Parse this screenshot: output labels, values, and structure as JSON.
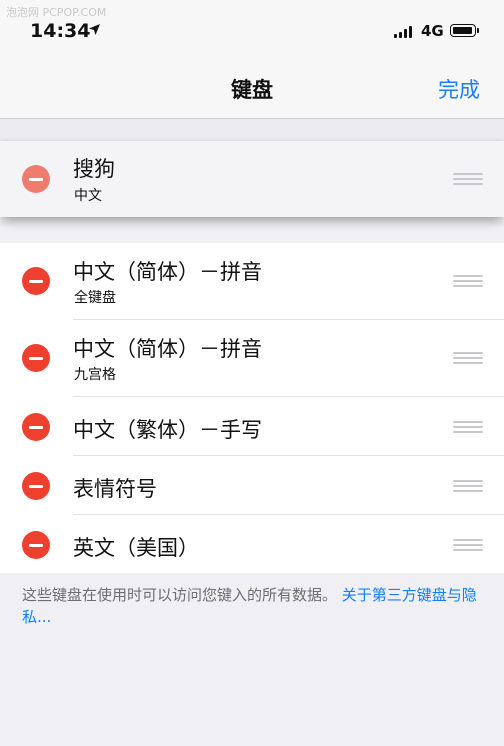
{
  "status_bar": {
    "watermark": "泡泡网 PCPOP.COM",
    "time": "14:34",
    "network": "4G"
  },
  "nav": {
    "title": "键盘",
    "done_label": "完成"
  },
  "keyboards": [
    {
      "title": "搜狗",
      "subtitle": "中文"
    },
    {
      "title": "中文（简体）－拼音",
      "subtitle": "全键盘"
    },
    {
      "title": "中文（简体）－拼音",
      "subtitle": "九宫格"
    },
    {
      "title": "中文（繁体）－手写",
      "subtitle": ""
    },
    {
      "title": "表情符号",
      "subtitle": ""
    },
    {
      "title": "英文（美国）",
      "subtitle": ""
    }
  ],
  "footer": {
    "text": "这些键盘在使用时可以访问您键入的所有数据。",
    "link": "关于第三方键盘与隐私..."
  },
  "colors": {
    "accent": "#147efb",
    "delete": "#ef3f2f"
  }
}
